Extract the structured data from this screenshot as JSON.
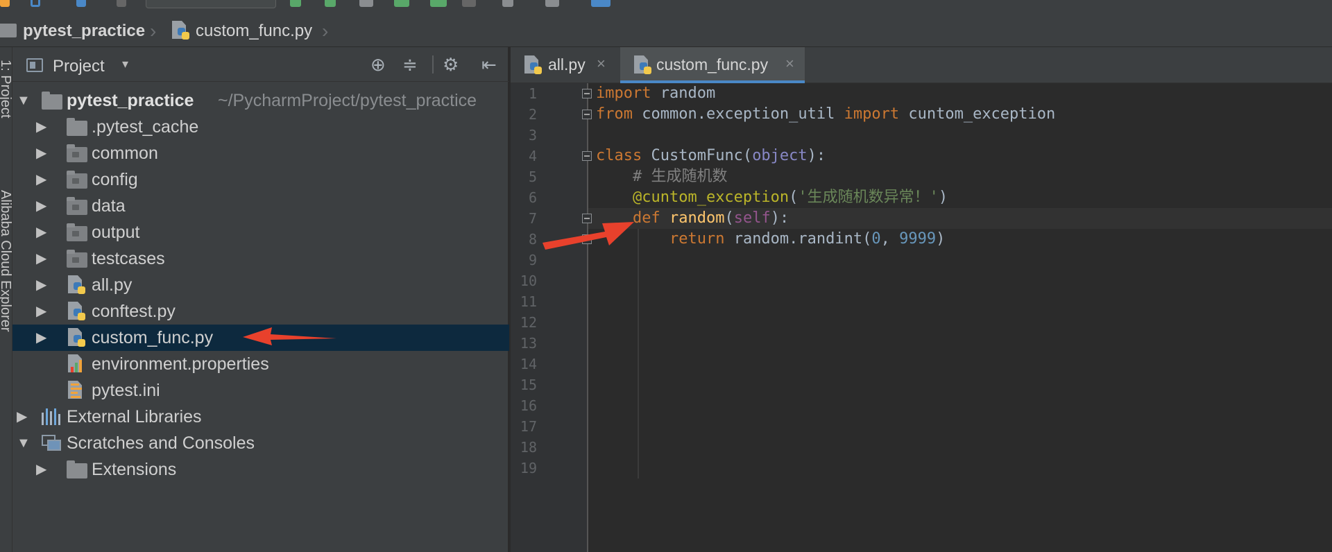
{
  "breadcrumb": {
    "project": "pytest_practice",
    "file": "custom_func.py"
  },
  "left_stripe": {
    "project_label": "1: Project",
    "explorer_label": "Alibaba Cloud Explorer"
  },
  "project_panel": {
    "title": "Project",
    "root": {
      "name": "pytest_practice",
      "path": "~/PycharmProject/pytest_practice"
    },
    "items": [
      {
        "label": ".pytest_cache",
        "type": "folder"
      },
      {
        "label": "common",
        "type": "folder"
      },
      {
        "label": "config",
        "type": "folder"
      },
      {
        "label": "data",
        "type": "folder"
      },
      {
        "label": "output",
        "type": "folder"
      },
      {
        "label": "testcases",
        "type": "folder"
      },
      {
        "label": "all.py",
        "type": "python-file"
      },
      {
        "label": "conftest.py",
        "type": "python-file"
      },
      {
        "label": "custom_func.py",
        "type": "python-file",
        "selected": true
      },
      {
        "label": "environment.properties",
        "type": "properties-file"
      },
      {
        "label": "pytest.ini",
        "type": "ini-file"
      }
    ],
    "external_libraries": "External Libraries",
    "scratches": "Scratches and Consoles",
    "extensions": "Extensions"
  },
  "editor": {
    "tabs": [
      {
        "label": "all.py",
        "active": false
      },
      {
        "label": "custom_func.py",
        "active": true
      }
    ],
    "line_numbers": [
      "1",
      "2",
      "3",
      "4",
      "5",
      "6",
      "7",
      "8",
      "9",
      "10",
      "11",
      "12",
      "13",
      "14",
      "15",
      "16",
      "17",
      "18",
      "19"
    ],
    "code": {
      "l1_kw": "import",
      "l1_rest": " random",
      "l2_kw1": "from",
      "l2_mod": " common.exception_util ",
      "l2_kw2": "import",
      "l2_name": " cuntom_exception",
      "l4_kw": "class",
      "l4_name": " CustomFunc(",
      "l4_base": "object",
      "l4_end": "):",
      "l5_comment": "# 生成随机数",
      "l6_dec": "@cuntom_exception",
      "l6_open": "(",
      "l6_str": "'生成随机数异常！'",
      "l6_close": ")",
      "l7_kw": "def",
      "l7_fn": "random",
      "l7_open": "(",
      "l7_self": "self",
      "l7_close": "):",
      "l8_kw": "return",
      "l8_call": " random.randint(",
      "l8_n1": "0",
      "l8_sep": ", ",
      "l8_n2": "9999",
      "l8_close": ")"
    }
  },
  "colors": {
    "keyword": "#cc7832",
    "string": "#6a8759",
    "number": "#6897bb",
    "comment": "#808080",
    "decorator": "#bbb529",
    "self": "#94558d",
    "annotation_arrow": "#e8412c",
    "selection": "#0d293e",
    "active_tab_underline": "#4a88c7"
  }
}
